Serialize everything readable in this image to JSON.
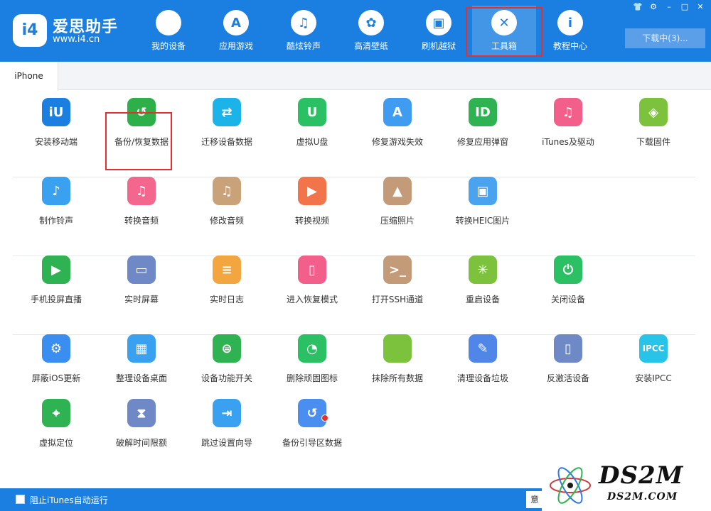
{
  "header": {
    "logo": {
      "badge": "i4",
      "name": "爱思助手",
      "url": "www.i4.cn"
    },
    "nav": [
      {
        "label": "我的设备",
        "icon": "apple-icon",
        "glyph": ""
      },
      {
        "label": "应用游戏",
        "icon": "app-store-icon",
        "glyph": "A"
      },
      {
        "label": "酷炫铃声",
        "icon": "bell-icon",
        "glyph": "♫"
      },
      {
        "label": "高清壁纸",
        "icon": "flower-icon",
        "glyph": "✿"
      },
      {
        "label": "刷机越狱",
        "icon": "box-icon",
        "glyph": "▣"
      },
      {
        "label": "工具箱",
        "icon": "tools-icon",
        "glyph": "✕"
      },
      {
        "label": "教程中心",
        "icon": "info-icon",
        "glyph": "i"
      }
    ],
    "active_nav": "工具箱",
    "window_controls": [
      "👕",
      "⚙",
      "–",
      "□",
      "✕"
    ],
    "download_button": "下载中(3)..."
  },
  "tabs": [
    {
      "label": "iPhone"
    }
  ],
  "tools": [
    {
      "label": "安装移动端",
      "icon": "i4-app-icon",
      "color": "#1a7fe0",
      "glyph": "iU"
    },
    {
      "label": "备份/恢复数据",
      "icon": "backup-restore-icon",
      "color": "#2db04a",
      "glyph": "↺"
    },
    {
      "label": "迁移设备数据",
      "icon": "migrate-data-icon",
      "color": "#1cb4e8",
      "glyph": "⇄"
    },
    {
      "label": "虚拟U盘",
      "icon": "usb-drive-icon",
      "color": "#2cc064",
      "glyph": "U"
    },
    {
      "label": "修复游戏失效",
      "icon": "repair-game-icon",
      "color": "#3f9cf0",
      "glyph": "A"
    },
    {
      "label": "修复应用弹窗",
      "icon": "repair-app-popup-icon",
      "color": "#2fb352",
      "glyph": "ID"
    },
    {
      "label": "iTunes及驱动",
      "icon": "itunes-driver-icon",
      "color": "#f25f8b",
      "glyph": "♫"
    },
    {
      "label": "下载固件",
      "icon": "firmware-download-icon",
      "color": "#7dc23d",
      "glyph": "◈"
    },
    {
      "label": "制作铃声",
      "icon": "make-ringtone-icon",
      "color": "#3aa0f0",
      "glyph": "♪"
    },
    {
      "label": "转换音频",
      "icon": "convert-audio-icon",
      "color": "#f3668e",
      "glyph": "♫"
    },
    {
      "label": "修改音频",
      "icon": "edit-audio-icon",
      "color": "#c9a27a",
      "glyph": "♫"
    },
    {
      "label": "转换视频",
      "icon": "convert-video-icon",
      "color": "#f2744b",
      "glyph": "▶"
    },
    {
      "label": "压缩照片",
      "icon": "compress-photo-icon",
      "color": "#c39b78",
      "glyph": "▲"
    },
    {
      "label": "转换HEIC图片",
      "icon": "convert-heic-icon",
      "color": "#4aa3ee",
      "glyph": "▣"
    },
    {
      "label": "手机投屏直播",
      "icon": "screen-cast-icon",
      "color": "#2fb352",
      "glyph": "▶"
    },
    {
      "label": "实时屏幕",
      "icon": "realtime-screen-icon",
      "color": "#6f89c6",
      "glyph": "▭"
    },
    {
      "label": "实时日志",
      "icon": "realtime-log-icon",
      "color": "#f3a640",
      "glyph": "≡"
    },
    {
      "label": "进入恢复模式",
      "icon": "recovery-mode-icon",
      "color": "#f25f8b",
      "glyph": "▯"
    },
    {
      "label": "打开SSH通道",
      "icon": "ssh-tunnel-icon",
      "color": "#c39b78",
      "glyph": ">_"
    },
    {
      "label": "重启设备",
      "icon": "restart-device-icon",
      "color": "#7dc23d",
      "glyph": "✳"
    },
    {
      "label": "关闭设备",
      "icon": "shutdown-device-icon",
      "color": "#2cc064",
      "glyph": "⏻"
    },
    {
      "label": "屏蔽iOS更新",
      "icon": "block-ios-update-icon",
      "color": "#3a8ef0",
      "glyph": "⚙"
    },
    {
      "label": "整理设备桌面",
      "icon": "organize-desktop-icon",
      "color": "#3aa0f0",
      "glyph": "▦"
    },
    {
      "label": "设备功能开关",
      "icon": "feature-toggle-icon",
      "color": "#2fb352",
      "glyph": "⊜"
    },
    {
      "label": "删除顽固图标",
      "icon": "delete-stubborn-icon",
      "color": "#2cc064",
      "glyph": "◔"
    },
    {
      "label": "抹除所有数据",
      "icon": "erase-all-data-icon",
      "color": "#7dc23d",
      "glyph": ""
    },
    {
      "label": "清理设备垃圾",
      "icon": "clean-junk-icon",
      "color": "#4f86e8",
      "glyph": "✎"
    },
    {
      "label": "反激活设备",
      "icon": "deactivate-device-icon",
      "color": "#6f89c6",
      "glyph": "▯"
    },
    {
      "label": "安装IPCC",
      "icon": "install-ipcc-icon",
      "color": "#27c3e8",
      "glyph": "IPCC"
    },
    {
      "label": "虚拟定位",
      "icon": "virtual-location-icon",
      "color": "#2fb352",
      "glyph": "⌖"
    },
    {
      "label": "破解时间限额",
      "icon": "time-limit-icon",
      "color": "#6f89c6",
      "glyph": "⧗"
    },
    {
      "label": "跳过设置向导",
      "icon": "skip-setup-icon",
      "color": "#3aa0f0",
      "glyph": "⇥"
    },
    {
      "label": "备份引导区数据",
      "icon": "backup-boot-icon",
      "color": "#4a8ff0",
      "glyph": "↺"
    }
  ],
  "footer": {
    "checkbox_label": "阻止iTunes自动运行",
    "right_button": "意"
  },
  "watermark": {
    "big": "DS2M",
    "small": "DS2M.COM"
  }
}
